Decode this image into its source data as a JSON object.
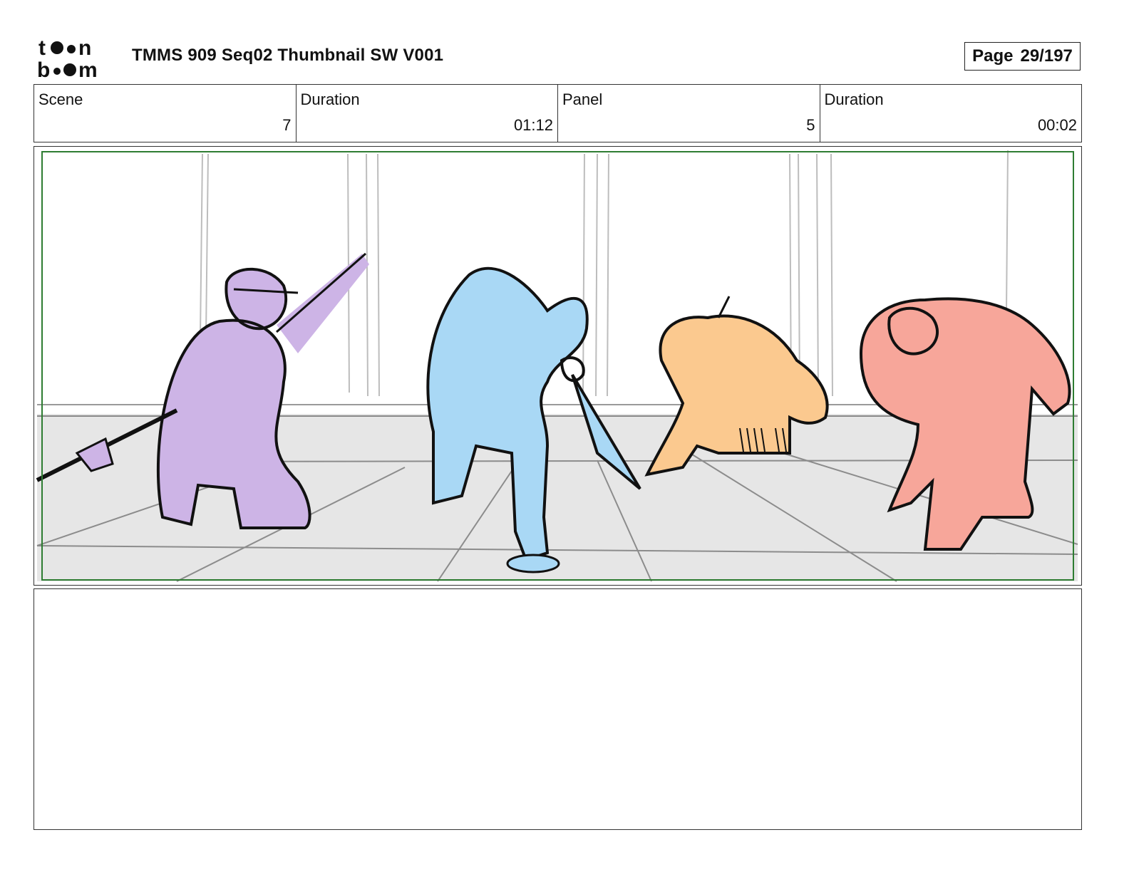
{
  "header": {
    "logo_text_top": "toon",
    "logo_text_bottom": "boom",
    "title": "TMMS 909 Seq02 Thumbnail SW V001",
    "page_label": "Page",
    "page_value": "29/197"
  },
  "info": {
    "scene_label": "Scene",
    "scene_value": "7",
    "scene_duration_label": "Duration",
    "scene_duration_value": "01:12",
    "panel_label": "Panel",
    "panel_value": "5",
    "panel_duration_label": "Duration",
    "panel_duration_value": "00:02"
  },
  "panel": {
    "frame_color": "#2e7d32",
    "character_colors": [
      "#cdb4e6",
      "#a9d8f5",
      "#fbc98f",
      "#f7a69a"
    ]
  },
  "notes": {
    "text": ""
  }
}
